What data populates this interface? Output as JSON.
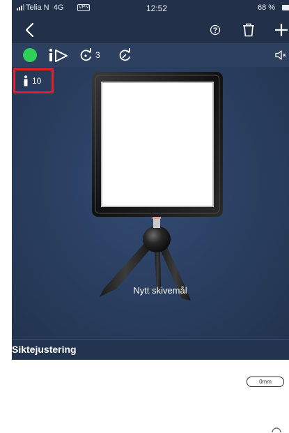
{
  "status_bar": {
    "carrier": "Telia N",
    "network": "4G",
    "network_badge": "VPN",
    "time": "12:52",
    "battery": "68 %"
  },
  "nav": {
    "back_icon": "chevron-left-icon",
    "help_icon": "question-circle-icon",
    "delete_icon": "trash-icon",
    "add_icon": "plus-icon"
  },
  "toolbar": {
    "status_color": "#2fcf5a",
    "play_icon": "info-play-icon",
    "sync_count": "3",
    "sync_icon": "refresh-shot-icon",
    "edit_sync_icon": "refresh-edit-icon",
    "sound_icon": "speaker-icon"
  },
  "stage": {
    "shot_count": "10",
    "target_label": "Nytt skivemål"
  },
  "section": {
    "title": "Siktejustering"
  },
  "adjustment": {
    "value": "0mm"
  },
  "colors": {
    "header_bg": "#22304a",
    "toolbar_bg": "#2e4060",
    "stage_bg": "#2b4063",
    "highlight": "#e5202e"
  }
}
